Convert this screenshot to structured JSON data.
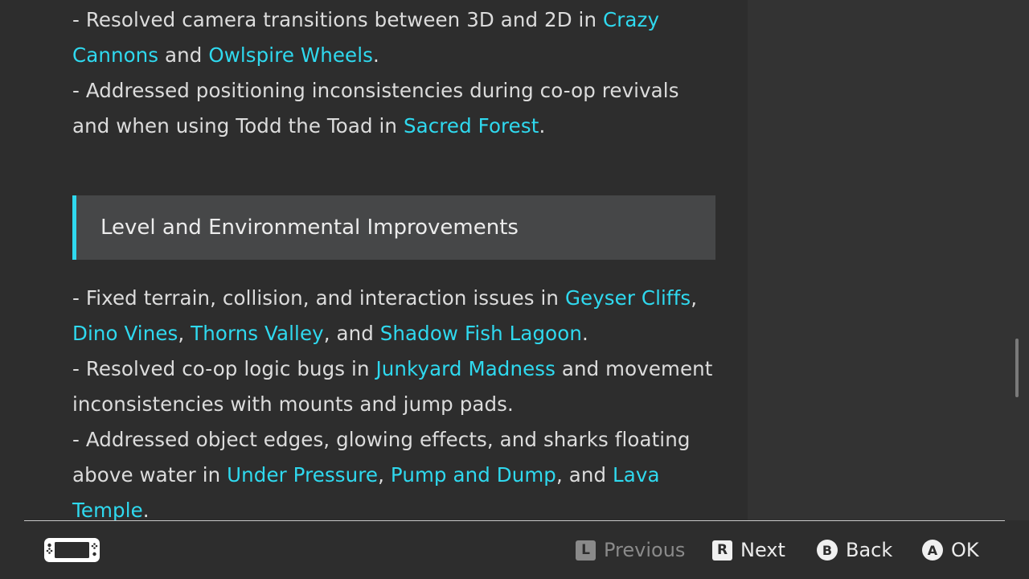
{
  "content": {
    "paragraph_1": {
      "t1": "- Resolved camera transitions between 3D and 2D in ",
      "l1": "Crazy Cannons",
      "t2": " and ",
      "l2": "Owlspire Wheels",
      "t3": "."
    },
    "paragraph_2": {
      "t1": "- Addressed positioning inconsistencies during co-op revivals and when using Todd the Toad in ",
      "l1": "Sacred Forest",
      "t2": "."
    },
    "section_title": "Level and Environmental Improvements",
    "paragraph_3": {
      "t1": "- Fixed terrain, collision, and interaction issues in ",
      "l1": "Geyser Cliffs",
      "t2": ", ",
      "l2": "Dino Vines",
      "t3": ", ",
      "l3": "Thorns Valley",
      "t4": ", and ",
      "l4": "Shadow Fish Lagoon",
      "t5": "."
    },
    "paragraph_4": {
      "t1": "- Resolved co-op logic bugs in ",
      "l1": "Junkyard Madness",
      "t2": " and movement inconsistencies with mounts and jump pads."
    },
    "paragraph_5": {
      "t1": "- Addressed object edges, glowing effects, and sharks floating above water in ",
      "l1": "Under Pressure",
      "t2": ", ",
      "l2": "Pump and Dump",
      "t3": ", and ",
      "l3": "Lava Temple",
      "t4": "."
    }
  },
  "footer": {
    "previous": {
      "glyph": "L",
      "label": "Previous",
      "enabled": false
    },
    "next": {
      "glyph": "R",
      "label": "Next"
    },
    "back": {
      "glyph": "B",
      "label": "Back"
    },
    "ok": {
      "glyph": "A",
      "label": "OK"
    }
  },
  "icons": {
    "console": "handheld-console-icon"
  },
  "colors": {
    "background": "#2d2d2d",
    "side_panel": "#333333",
    "link": "#2fd9ef",
    "section_header_bg": "#464748",
    "text": "#dcdcdc"
  }
}
